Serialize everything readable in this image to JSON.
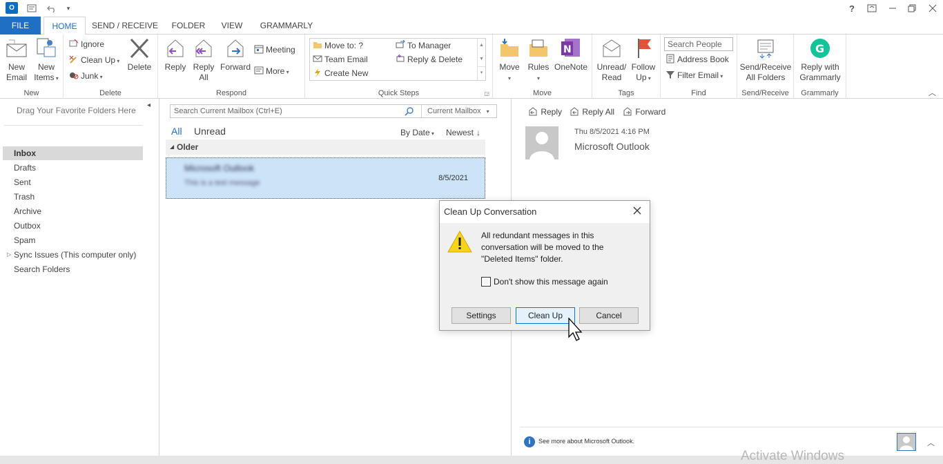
{
  "quick_access": {
    "icons": [
      "outlook-logo",
      "send-receive-icon",
      "undo-icon",
      "customize-icon"
    ],
    "logo_text": "O"
  },
  "window": {
    "help": "?",
    "icons": [
      "ribbon-display-icon",
      "minimize-icon",
      "restore-icon",
      "close-icon"
    ]
  },
  "tabs": [
    {
      "label": "FILE",
      "name": "tab-file"
    },
    {
      "label": "HOME",
      "name": "tab-home"
    },
    {
      "label": "SEND / RECEIVE",
      "name": "tab-send-receive"
    },
    {
      "label": "FOLDER",
      "name": "tab-folder"
    },
    {
      "label": "VIEW",
      "name": "tab-view"
    },
    {
      "label": "GRAMMARLY",
      "name": "tab-grammarly"
    }
  ],
  "ribbon": {
    "new": {
      "label": "New",
      "new_email": [
        "New",
        "Email"
      ],
      "new_items": [
        "New",
        "Items"
      ]
    },
    "delete": {
      "label": "Delete",
      "ignore": "Ignore",
      "clean_up": "Clean Up",
      "junk": "Junk",
      "delete": "Delete"
    },
    "respond": {
      "label": "Respond",
      "reply": "Reply",
      "reply_all": [
        "Reply",
        "All"
      ],
      "forward": "Forward",
      "meeting": "Meeting",
      "more": "More"
    },
    "quick_steps": {
      "label": "Quick Steps",
      "items": [
        "Move to: ?",
        "Team Email",
        "Create New",
        "To Manager",
        "Reply & Delete"
      ]
    },
    "move": {
      "label": "Move",
      "move": "Move",
      "rules": "Rules",
      "onenote": "OneNote"
    },
    "tags": {
      "label": "Tags",
      "unread_read": [
        "Unread/",
        "Read"
      ],
      "follow_up": [
        "Follow",
        "Up"
      ]
    },
    "find": {
      "label": "Find",
      "search_people": "Search People",
      "address_book": "Address Book",
      "filter_email": "Filter Email"
    },
    "send_receive": {
      "label": "Send/Receive",
      "button": [
        "Send/Receive",
        "All Folders"
      ]
    },
    "grammarly": {
      "label": "Grammarly",
      "button": [
        "Reply with",
        "Grammarly"
      ]
    }
  },
  "nav": {
    "hint": "Drag Your Favorite Folders Here",
    "folders": [
      "Inbox",
      "Drafts",
      "Sent",
      "Trash",
      "Archive",
      "Outbox",
      "Spam",
      "Sync Issues (This computer only)",
      "Search Folders"
    ],
    "selected": "Inbox"
  },
  "list": {
    "search_placeholder": "Search Current Mailbox (Ctrl+E)",
    "scope": "Current Mailbox",
    "filter_all": "All",
    "filter_unread": "Unread",
    "sort_by": "By Date",
    "order": "Newest",
    "group_header": "Older",
    "message": {
      "sender": "Microsoft Outlook",
      "preview": "This is a test message",
      "date": "8/5/2021"
    }
  },
  "reading": {
    "reply": "Reply",
    "reply_all": "Reply All",
    "forward": "Forward",
    "timestamp": "Thu 8/5/2021 4:16 PM",
    "sender": "Microsoft Outlook",
    "info_text": "See more about Microsoft Outlook."
  },
  "watermark": "Activate Windows",
  "dialog": {
    "title": "Clean Up Conversation",
    "message_lines": [
      "All redundant messages in this",
      "conversation will be moved to the",
      "\"Deleted Items\" folder."
    ],
    "checkbox_label": "Don't show this message again",
    "buttons": {
      "settings": "Settings",
      "clean_up": "Clean Up",
      "cancel": "Cancel"
    }
  },
  "colors": {
    "accent": "#1f6fc5",
    "selection": "#cce4f7",
    "warning": "#f7d31a",
    "onenote": "#7b3aa5",
    "grammarly": "#15c39a",
    "flag": "#e0533a"
  }
}
